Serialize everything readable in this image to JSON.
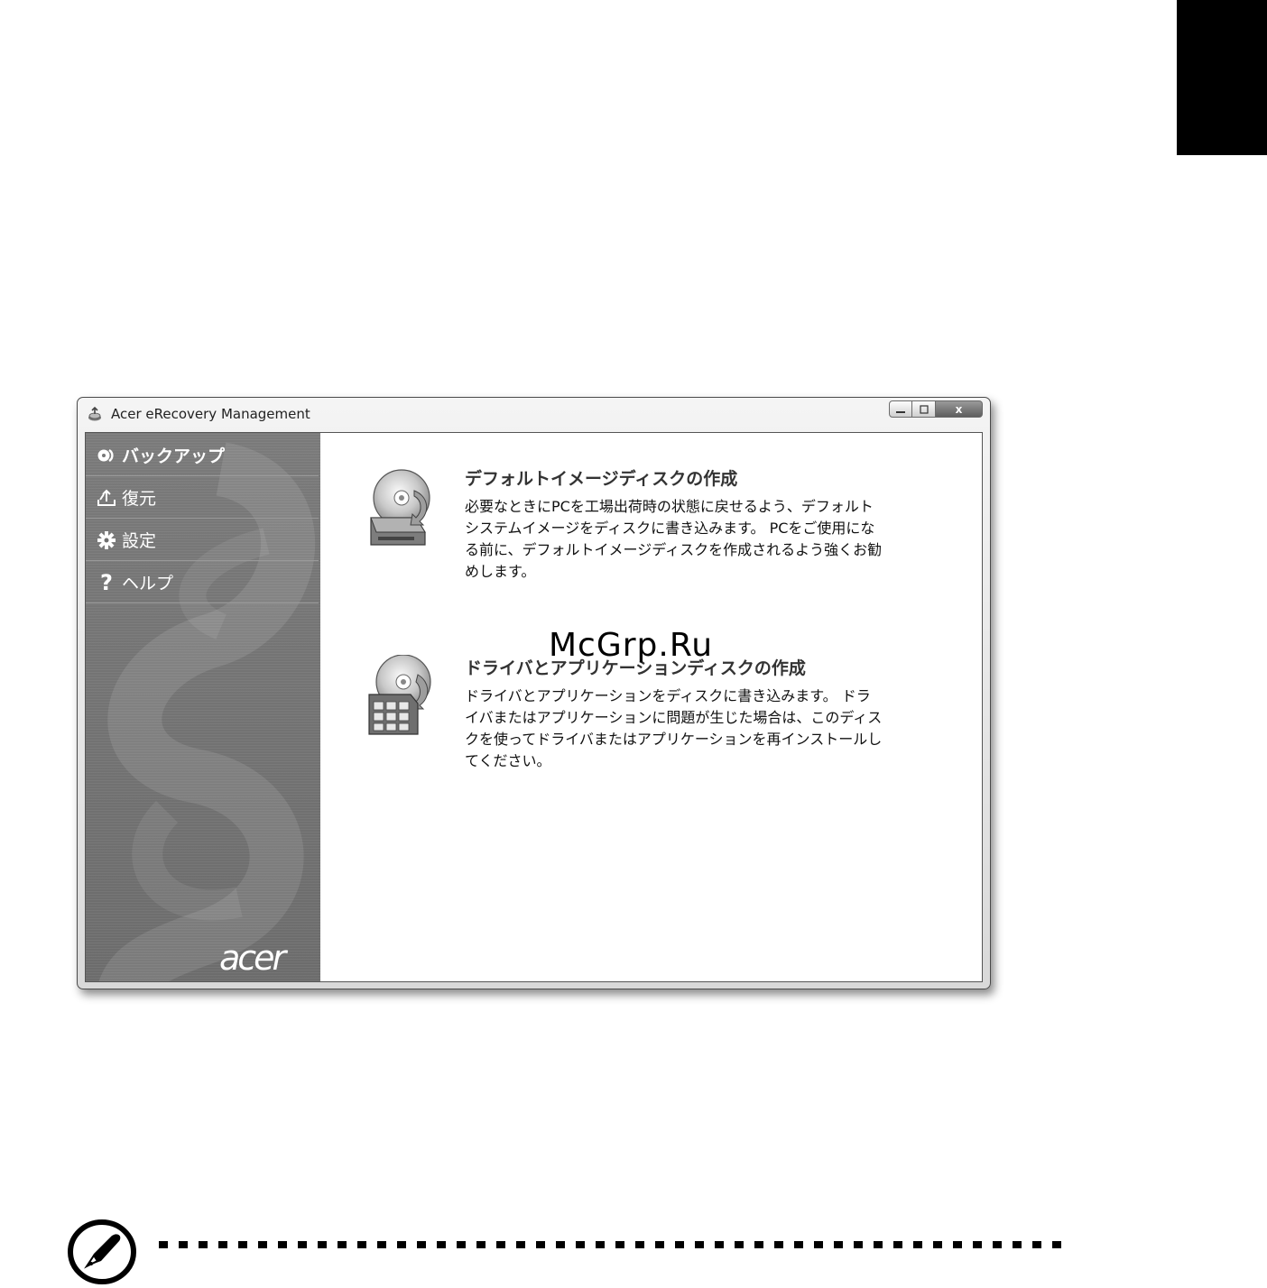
{
  "window": {
    "title": "Acer eRecovery Management",
    "buttons": {
      "minimize": "–",
      "maximize": "□",
      "close": "x"
    }
  },
  "sidebar": {
    "items": [
      {
        "label": "バックアップ",
        "icon": "disc-icon",
        "active": true
      },
      {
        "label": "復元",
        "icon": "restore-icon",
        "active": false
      },
      {
        "label": "設定",
        "icon": "gear-icon",
        "active": false
      },
      {
        "label": "ヘルプ",
        "icon": "help-icon",
        "active": false
      }
    ],
    "logo": "acer"
  },
  "content": {
    "options": [
      {
        "title": "デフォルトイメージディスクの作成",
        "description": "必要なときにPCを工場出荷時の状態に戻せるよう、デフォルト\nシステムイメージをディスクに書き込みます。 PCをご使用にな\nる前に、デフォルトイメージディスクを作成されるよう強くお勧\nめします。",
        "icon": "disc-drive-icon"
      },
      {
        "title": "ドライバとアプリケーションディスクの作成",
        "description": "ドライバとアプリケーションをディスクに書き込みます。 ドラ\nイバまたはアプリケーションに問題が生じた場合は、このディス\nクを使ってドライバまたはアプリケーションを再インストールし\nてください。",
        "icon": "disc-apps-icon"
      }
    ],
    "tip_icon": "lightbulb-icon"
  },
  "watermark": "McGrp.Ru",
  "note": {
    "icon": "note-pen-icon"
  }
}
